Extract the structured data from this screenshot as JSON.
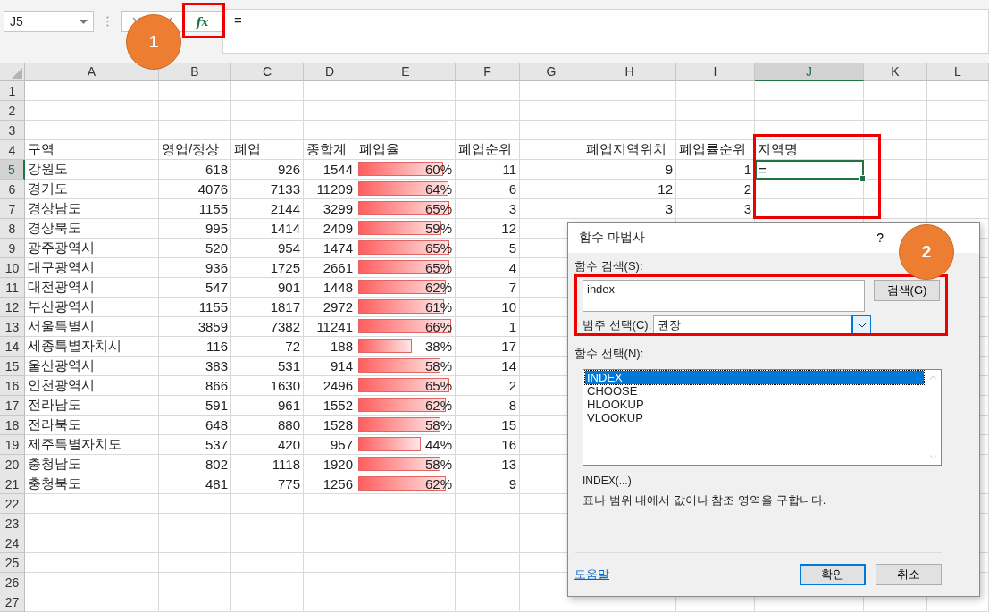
{
  "name_box": {
    "value": "J5"
  },
  "formula_bar": {
    "fx_label": "fx",
    "value": "="
  },
  "callouts": [
    {
      "label": "1"
    },
    {
      "label": "2"
    }
  ],
  "columns": [
    {
      "label": "A",
      "selected": false
    },
    {
      "label": "B",
      "selected": false
    },
    {
      "label": "C",
      "selected": false
    },
    {
      "label": "D",
      "selected": false
    },
    {
      "label": "E",
      "selected": false
    },
    {
      "label": "F",
      "selected": false
    },
    {
      "label": "G",
      "selected": false
    },
    {
      "label": "H",
      "selected": false
    },
    {
      "label": "I",
      "selected": false
    },
    {
      "label": "J",
      "selected": true
    },
    {
      "label": "K",
      "selected": false
    },
    {
      "label": "L",
      "selected": false
    }
  ],
  "rows": [
    {
      "number": "1",
      "selected": false
    },
    {
      "number": "2",
      "selected": false
    },
    {
      "number": "3",
      "selected": false
    },
    {
      "number": "4",
      "selected": false,
      "kind": "header",
      "cells": {
        "a": "구역",
        "b": "영업/정상",
        "c": "폐업",
        "d": "종합계",
        "e": "폐업율",
        "f": "폐업순위",
        "h": "폐업지역위치",
        "i": "폐업률순위",
        "j": "지역명"
      }
    },
    {
      "number": "5",
      "selected": true,
      "kind": "data",
      "cells": {
        "a": "강원도",
        "b": "618",
        "c": "926",
        "d": "1544",
        "e": {
          "text": "60%",
          "level": 0.91
        },
        "f": "11",
        "h": "9",
        "i": "1",
        "j": "="
      }
    },
    {
      "number": "6",
      "selected": false,
      "kind": "data",
      "cells": {
        "a": "경기도",
        "b": "4076",
        "c": "7133",
        "d": "11209",
        "e": {
          "text": "64%",
          "level": 0.97
        },
        "f": "6",
        "h": "12",
        "i": "2"
      }
    },
    {
      "number": "7",
      "selected": false,
      "kind": "data",
      "cells": {
        "a": "경상남도",
        "b": "1155",
        "c": "2144",
        "d": "3299",
        "e": {
          "text": "65%",
          "level": 0.98
        },
        "f": "3",
        "h": "3",
        "i": "3"
      }
    },
    {
      "number": "8",
      "selected": false,
      "kind": "data",
      "cells": {
        "a": "경상북도",
        "b": "995",
        "c": "1414",
        "d": "2409",
        "e": {
          "text": "59%",
          "level": 0.89
        },
        "f": "12"
      }
    },
    {
      "number": "9",
      "selected": false,
      "kind": "data",
      "cells": {
        "a": "광주광역시",
        "b": "520",
        "c": "954",
        "d": "1474",
        "e": {
          "text": "65%",
          "level": 0.98
        },
        "f": "5"
      }
    },
    {
      "number": "10",
      "selected": false,
      "kind": "data",
      "cells": {
        "a": "대구광역시",
        "b": "936",
        "c": "1725",
        "d": "2661",
        "e": {
          "text": "65%",
          "level": 0.98
        },
        "f": "4"
      }
    },
    {
      "number": "11",
      "selected": false,
      "kind": "data",
      "cells": {
        "a": "대전광역시",
        "b": "547",
        "c": "901",
        "d": "1448",
        "e": {
          "text": "62%",
          "level": 0.94
        },
        "f": "7"
      }
    },
    {
      "number": "12",
      "selected": false,
      "kind": "data",
      "cells": {
        "a": "부산광역시",
        "b": "1155",
        "c": "1817",
        "d": "2972",
        "e": {
          "text": "61%",
          "level": 0.92
        },
        "f": "10"
      }
    },
    {
      "number": "13",
      "selected": false,
      "kind": "data",
      "cells": {
        "a": "서울특별시",
        "b": "3859",
        "c": "7382",
        "d": "11241",
        "e": {
          "text": "66%",
          "level": 1.0
        },
        "f": "1"
      }
    },
    {
      "number": "14",
      "selected": false,
      "kind": "data",
      "cells": {
        "a": "세종특별자치시",
        "b": "116",
        "c": "72",
        "d": "188",
        "e": {
          "text": "38%",
          "level": 0.58
        },
        "f": "17"
      }
    },
    {
      "number": "15",
      "selected": false,
      "kind": "data",
      "cells": {
        "a": "울산광역시",
        "b": "383",
        "c": "531",
        "d": "914",
        "e": {
          "text": "58%",
          "level": 0.88
        },
        "f": "14"
      }
    },
    {
      "number": "16",
      "selected": false,
      "kind": "data",
      "cells": {
        "a": "인천광역시",
        "b": "866",
        "c": "1630",
        "d": "2496",
        "e": {
          "text": "65%",
          "level": 0.98
        },
        "f": "2"
      }
    },
    {
      "number": "17",
      "selected": false,
      "kind": "data",
      "cells": {
        "a": "전라남도",
        "b": "591",
        "c": "961",
        "d": "1552",
        "e": {
          "text": "62%",
          "level": 0.94
        },
        "f": "8"
      }
    },
    {
      "number": "18",
      "selected": false,
      "kind": "data",
      "cells": {
        "a": "전라북도",
        "b": "648",
        "c": "880",
        "d": "1528",
        "e": {
          "text": "58%",
          "level": 0.88
        },
        "f": "15"
      }
    },
    {
      "number": "19",
      "selected": false,
      "kind": "data",
      "cells": {
        "a": "제주특별자치도",
        "b": "537",
        "c": "420",
        "d": "957",
        "e": {
          "text": "44%",
          "level": 0.67
        },
        "f": "16"
      }
    },
    {
      "number": "20",
      "selected": false,
      "kind": "data",
      "cells": {
        "a": "충청남도",
        "b": "802",
        "c": "1118",
        "d": "1920",
        "e": {
          "text": "58%",
          "level": 0.88
        },
        "f": "13"
      }
    },
    {
      "number": "21",
      "selected": false,
      "kind": "data",
      "cells": {
        "a": "충청북도",
        "b": "481",
        "c": "775",
        "d": "1256",
        "e": {
          "text": "62%",
          "level": 0.94
        },
        "f": "9"
      }
    },
    {
      "number": "22",
      "selected": false
    },
    {
      "number": "23",
      "selected": false
    },
    {
      "number": "24",
      "selected": false
    },
    {
      "number": "25",
      "selected": false
    },
    {
      "number": "26",
      "selected": false
    },
    {
      "number": "27",
      "selected": false
    }
  ],
  "dialog": {
    "title": "함수 마법사",
    "help": "?",
    "search_label": "함수 검색(S):",
    "search_value": "index",
    "search_button": "검색(G)",
    "category_label": "범주 선택(C):",
    "category_value": "권장",
    "list_label": "함수 선택(N):",
    "functions": [
      {
        "name": "INDEX",
        "selected": true
      },
      {
        "name": "CHOOSE",
        "selected": false
      },
      {
        "name": "HLOOKUP",
        "selected": false
      },
      {
        "name": "VLOOKUP",
        "selected": false
      }
    ],
    "signature": "INDEX(...)",
    "description": "표나 범위 내에서 값이나 참조 영역을 구합니다.",
    "help_link": "도움말",
    "buttons": [
      {
        "label": "확인",
        "kind": "default"
      },
      {
        "label": "취소",
        "kind": "normal"
      }
    ]
  }
}
